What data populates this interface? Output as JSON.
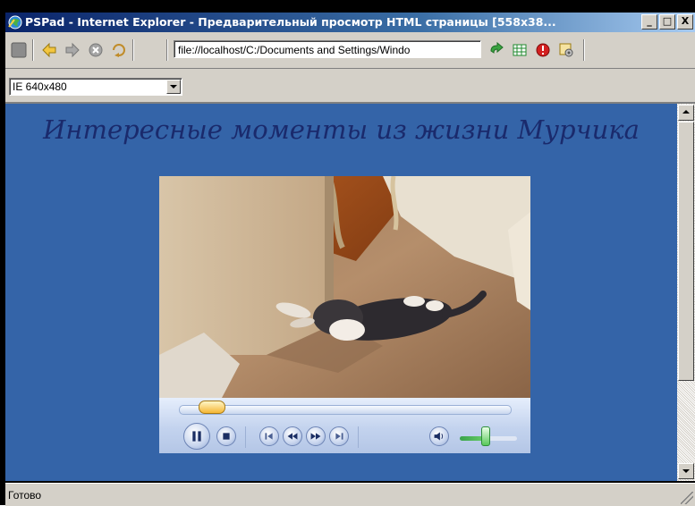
{
  "window": {
    "title": "PSPad - Internet Explorer - Предварительный просмотр HTML страницы  [558x38...",
    "controls": {
      "minimize": "_",
      "maximize": "□",
      "close": "X"
    }
  },
  "toolbar": {
    "buttons": [
      "stop-square-icon",
      "back-arrow-icon",
      "forward-arrow-icon",
      "stop-icon",
      "refresh-icon",
      "go-icon",
      "grid-icon",
      "alert-icon",
      "settings-icon"
    ],
    "address": "file://localhost/C:/Documents and Settings/Windo"
  },
  "viewport_select": {
    "value": "IE 640x480"
  },
  "page": {
    "heading": "Интересные моменты из жизни Мурчика"
  },
  "player": {
    "progress": 0.12,
    "volume": 0.6,
    "buttons": [
      "pause-icon",
      "stop-icon",
      "previous-icon",
      "rewind-icon",
      "fast-forward-icon",
      "next-icon",
      "mute-icon"
    ]
  },
  "status": {
    "text": "Готово"
  },
  "colors": {
    "page_background": "#3464a8",
    "heading": "#1a2a6c",
    "titlebar": "#0a246a"
  }
}
